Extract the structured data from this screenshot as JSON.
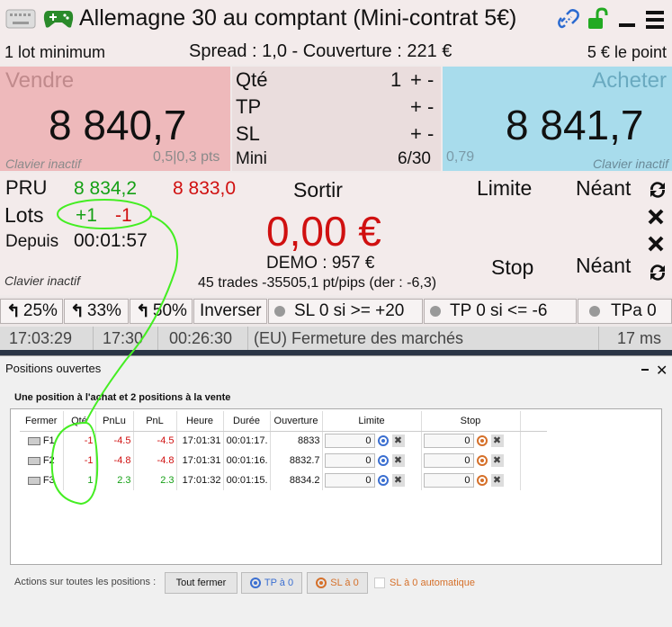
{
  "header": {
    "title": "Allemagne 30 au comptant (Mini-contrat 5€)"
  },
  "info": {
    "min_lot": "1 lot minimum",
    "spread": "Spread : 1,0 - Couverture : 221 €",
    "point_value": "5 € le point"
  },
  "sell": {
    "label": "Vendre",
    "price": "8 840,7",
    "keyboard": "Clavier inactif",
    "spread_pts": "0,5|0,3 pts"
  },
  "mid": {
    "qty_label": "Qté",
    "qty_value": "1",
    "tp_label": "TP",
    "sl_label": "SL",
    "mini_label": "Mini",
    "mini_value": "6/30",
    "plusminus": "+ -"
  },
  "buy": {
    "label": "Acheter",
    "price": "8 841,7",
    "spread": "0,79",
    "keyboard": "Clavier inactif"
  },
  "position": {
    "pru_label": "PRU",
    "pru_buy": "8 834,2",
    "pru_sell": "8 833,0",
    "lots_label": "Lots",
    "lots_buy": "+1",
    "lots_sell": "-1",
    "since_label": "Depuis",
    "since_value": "00:01:57",
    "keyboard": "Clavier inactif",
    "exit_label": "Sortir",
    "pnl": "0,00 €",
    "demo": "DEMO : 957 €",
    "stats": "45 trades -35505,1 pt/pips (der : -6,3)",
    "limit_label": "Limite",
    "limit_value": "Néant",
    "stop_label": "Stop",
    "stop_value": "Néant"
  },
  "buttons": {
    "pct25": "25%",
    "pct33": "33%",
    "pct50": "50%",
    "invert": "Inverser",
    "sl0": "SL 0 si >= +20",
    "tp0": "TP 0 si <= -6",
    "tpa0": "TPa 0"
  },
  "status": {
    "time": "17:03:29",
    "time2": "17:30",
    "countdown": "00:26:30",
    "market": "(EU)  Fermeture des marchés",
    "latency": "17 ms"
  },
  "dialog": {
    "title": "Positions ouvertes",
    "subtitle": "Une position à l'achat et 2 positions à la vente",
    "columns": [
      "Fermer",
      "Qté",
      "PnLu",
      "PnL",
      "Heure",
      "Durée",
      "Ouverture",
      "Limite",
      "Stop"
    ],
    "rows": [
      {
        "close": "F1",
        "qty": "-1",
        "pnlu": "-4.5",
        "pnl": "-4.5",
        "time": "17:01:31",
        "duration": "00:01:17.",
        "open": "8833",
        "limit": "0",
        "stop": "0"
      },
      {
        "close": "F2",
        "qty": "-1",
        "pnlu": "-4.8",
        "pnl": "-4.8",
        "time": "17:01:31",
        "duration": "00:01:16.",
        "open": "8832.7",
        "limit": "0",
        "stop": "0"
      },
      {
        "close": "F3",
        "qty": "1",
        "pnlu": "2.3",
        "pnl": "2.3",
        "time": "17:01:32",
        "duration": "00:01:15.",
        "open": "8834.2",
        "limit": "0",
        "stop": "0"
      }
    ],
    "actions_label": "Actions sur toutes les positions :",
    "close_all": "Tout fermer",
    "tp_zero": "TP à 0",
    "sl_zero": "SL à 0",
    "sl_auto": "SL à 0 automatique"
  },
  "colors": {
    "sell_bg": "#eeb9bb",
    "buy_bg": "#a8dcec",
    "green": "#15a015",
    "red": "#d01010",
    "annotation": "#44ee22"
  }
}
